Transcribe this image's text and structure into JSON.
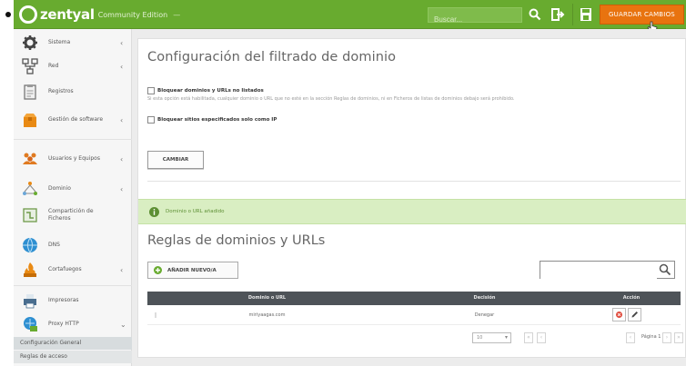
{
  "brand": {
    "name": "zentyal",
    "edition": "Community Edition",
    "version": "—"
  },
  "topbar": {
    "search_placeholder": "Buscar...",
    "save_label": "GUARDAR CAMBIOS"
  },
  "sidebar": {
    "items": [
      {
        "label": "Sistema",
        "icon": "gear-icon",
        "chevron": "‹"
      },
      {
        "label": "Red",
        "icon": "network-icon",
        "chevron": "‹"
      },
      {
        "label": "Registros",
        "icon": "clipboard-icon",
        "chevron": ""
      },
      {
        "label": "Gestión de software",
        "icon": "package-icon",
        "chevron": "‹"
      },
      {
        "label": "Usuarios y Equipos",
        "icon": "users-icon",
        "chevron": "‹"
      },
      {
        "label": "Dominio",
        "icon": "domain-icon",
        "chevron": "‹"
      },
      {
        "label": "Compartición de Ficheros",
        "icon": "folder-share-icon",
        "chevron": ""
      },
      {
        "label": "DNS",
        "icon": "dns-icon",
        "chevron": ""
      },
      {
        "label": "Cortafuegos",
        "icon": "firewall-icon",
        "chevron": "‹"
      },
      {
        "label": "Impresoras",
        "icon": "printer-icon",
        "chevron": ""
      },
      {
        "label": "Proxy HTTP",
        "icon": "proxy-icon",
        "chevron": "⌄"
      }
    ],
    "subitems": [
      "Configuración General",
      "Reglas de acceso"
    ]
  },
  "main": {
    "title": "Configuración del filtrado de dominio",
    "options": [
      {
        "label": "Bloquear dominios y URLs no listados",
        "help": "Si esta opción está habilitada, cualquier dominio o URL que no esté en la sección Reglas de dominios, ni en Ficheros de listas de dominios debajo será prohibido.",
        "checked": false
      },
      {
        "label": "Bloquear sitios especificados solo como IP",
        "help": "",
        "checked": false
      }
    ],
    "change_button": "CAMBIAR",
    "notice": "Dominio o URL añadido",
    "rules_title": "Reglas de dominios y URLs",
    "add_button": "AÑADIR NUEVO/A",
    "table": {
      "headers": [
        "Dominio o URL",
        "Decisión",
        "Acción"
      ],
      "rows": [
        {
          "domain": "miriyaagas.com",
          "decision": "Denegar"
        }
      ]
    },
    "pager": {
      "page_size": "10",
      "page_label": "Página 1"
    }
  },
  "colors": {
    "topbar": "#68ab2f",
    "save_button": "#e8730f",
    "notice_bg": "#d9eec2",
    "table_header": "#4e5358"
  }
}
